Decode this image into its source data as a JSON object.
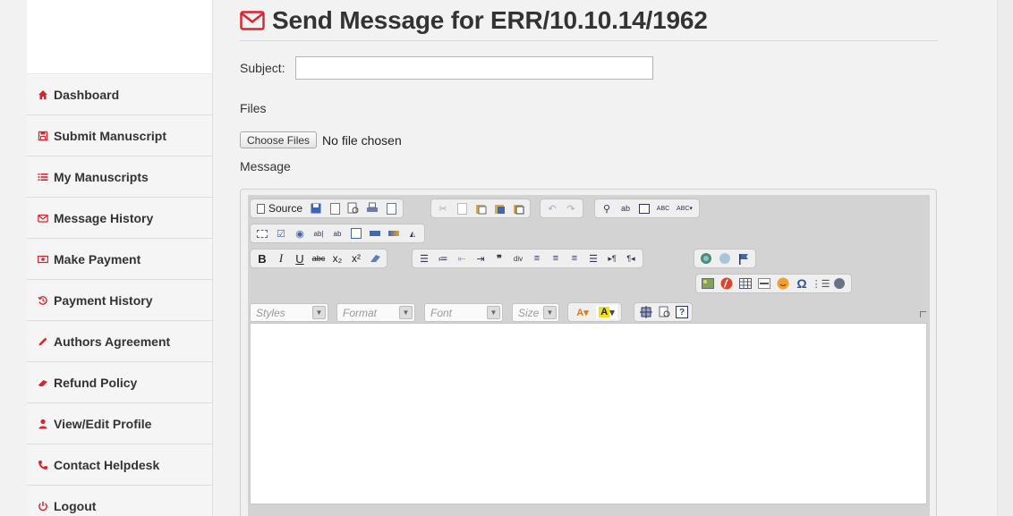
{
  "sidebar": {
    "items": [
      {
        "label": "Dashboard",
        "icon": "home-icon"
      },
      {
        "label": "Submit Manuscript",
        "icon": "save-icon"
      },
      {
        "label": "My Manuscripts",
        "icon": "list-icon"
      },
      {
        "label": "Message History",
        "icon": "envelope-icon"
      },
      {
        "label": "Make Payment",
        "icon": "money-icon"
      },
      {
        "label": "Payment History",
        "icon": "history-icon"
      },
      {
        "label": "Authors Agreement",
        "icon": "pencil-icon"
      },
      {
        "label": "Refund Policy",
        "icon": "eraser-icon"
      },
      {
        "label": "View/Edit Profile",
        "icon": "user-icon"
      },
      {
        "label": "Contact Helpdesk",
        "icon": "phone-icon"
      },
      {
        "label": "Logout",
        "icon": "power-icon"
      }
    ]
  },
  "main": {
    "title": "Send Message for ERR/10.10.14/1962",
    "title_icon": "envelope-icon",
    "subject_label": "Subject:",
    "subject_value": "",
    "files_label": "Files",
    "choose_files_label": "Choose Files",
    "no_file_text": "No file chosen",
    "message_label": "Message"
  },
  "editor": {
    "source_label": "Source",
    "combos": [
      "Styles",
      "Format",
      "Font",
      "Size"
    ]
  },
  "colors": {
    "accent": "#d9232d",
    "background": "#f2f2f2"
  }
}
